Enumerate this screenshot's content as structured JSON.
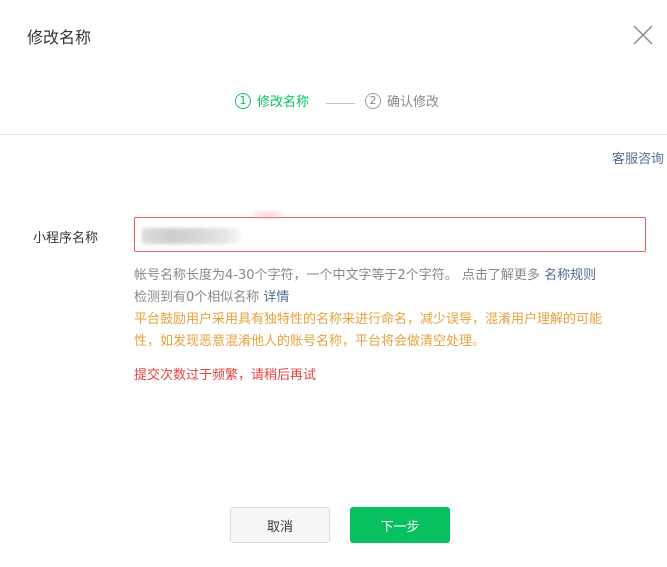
{
  "dialog": {
    "title": "修改名称",
    "close_icon": "close-icon"
  },
  "steps": [
    {
      "number": "1",
      "label": "修改名称",
      "state": "active"
    },
    {
      "number": "2",
      "label": "确认修改",
      "state": "pending"
    }
  ],
  "links": {
    "customer_service": "客服咨询"
  },
  "form": {
    "label": "小程序名称",
    "input_value_note": "blurred"
  },
  "help": {
    "rule_text": "帐号名称长度为4-30个字符，一个中文字等于2个字符。 点击了解更多",
    "rule_link": "名称规则",
    "similar_text": "检测到有0个相似名称",
    "similar_link": "详情",
    "warning_line1": "平台鼓励用户采用具有独特性的名称来进行命名，减少误导，混淆用户理解的可能",
    "warning_line2": "性，如发现恶意混淆他人的账号名称，平台将会做清空处理。",
    "error": "提交次数过于频繁，请稍后再试"
  },
  "buttons": {
    "cancel": "取消",
    "next": "下一步"
  },
  "colors": {
    "accent_green": "#07c160",
    "link_blue": "#576b95",
    "warning_orange": "#e6a23c",
    "error_red": "#e64340",
    "input_error_border": "#e15f5f"
  }
}
